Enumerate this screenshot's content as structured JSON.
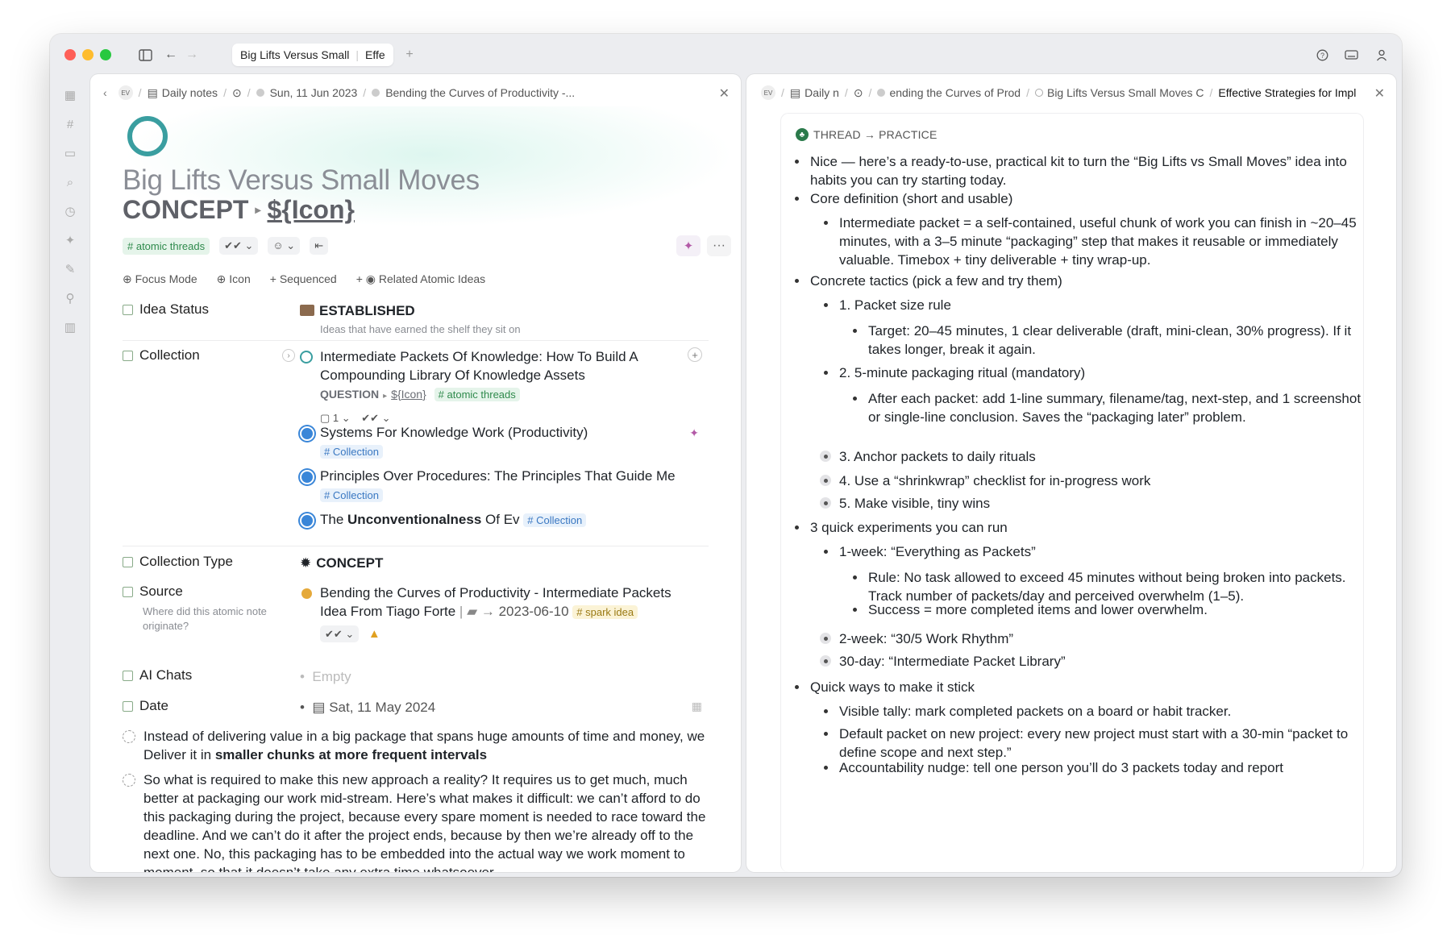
{
  "window": {
    "tabs": [
      {
        "label": "Big Lifts Versus Small",
        "active": true
      },
      {
        "label": "Effe",
        "active": true
      }
    ],
    "new_tab": "+"
  },
  "left_pane": {
    "breadcrumb": {
      "workspace": "EV",
      "daily_notes": "Daily notes",
      "date": "Sun, 11 Jun 2023",
      "parent": "Bending the Curves of Productivity -..."
    },
    "title": "Big Lifts Versus Small Moves",
    "type": "CONCEPT",
    "type_link": "${Icon}",
    "tag": "# atomic threads",
    "props_bar": {
      "focus_mode": "Focus Mode",
      "icon": "Icon",
      "sequenced": "Sequenced",
      "related": "Related Atomic Ideas"
    },
    "idea_status": {
      "label": "Idea Status",
      "value": "ESTABLISHED",
      "sub": "Ideas that have earned the shelf they sit on"
    },
    "collection": {
      "label": "Collection",
      "items": [
        {
          "title": "Intermediate Packets Of Knowledge: How To Build A Compounding Library Of Knowledge Assets",
          "type": "QUESTION",
          "type_link": "${Icon}",
          "tag": "# atomic threads",
          "count": "1"
        },
        {
          "title": "Systems For Knowledge Work (Productivity)",
          "tag": "# Collection"
        },
        {
          "title": "Principles Over Procedures: The Principles That Guide Me",
          "tag": "# Collection"
        },
        {
          "title_pre": "The ",
          "title_bold": "Unconventionalness",
          "title_post": " Of Ev",
          "tag": "# Collection"
        }
      ]
    },
    "collection_type": {
      "label": "Collection Type",
      "value": "CONCEPT"
    },
    "source": {
      "label": "Source",
      "sub": "Where did this atomic note originate?",
      "title": "Bending the Curves of Productivity - Intermediate Packets Idea From Tiago Forte",
      "date": "2023-06-10",
      "tag": "# spark idea"
    },
    "ai_chats": {
      "label": "AI Chats",
      "value": "Empty"
    },
    "date": {
      "label": "Date",
      "value": "Sat, 11 May 2024"
    },
    "notes": [
      {
        "pre": "Instead of delivering value in a big package that spans huge amounts of time and money, we Deliver it in ",
        "bold": "smaller chunks at more frequent intervals"
      },
      {
        "text": "So what is required to make this new approach a reality? It requires us to get much, much better at packaging our work mid-stream. Here’s what makes it difficult: we can’t afford to do this packaging during the project, because every spare moment is needed to race toward the deadline. And we can’t do it after the project ends, because by then we’re already off to the next one. No, this packaging has to be embedded into the actual way we work moment to moment, so that it doesn’t take any extra time whatsoever."
      }
    ]
  },
  "right_pane": {
    "breadcrumb": {
      "workspace": "EV",
      "daily": "Daily n",
      "c1": "ending the Curves of Prod",
      "c2": "Big Lifts Versus Small Moves C",
      "current": "Effective Strategies for Impl"
    },
    "thread_header": "THREAD → PRACTICE",
    "items": [
      {
        "level": 0,
        "text": "Nice — here’s a ready-to-use, practical kit to turn the “Big Lifts vs Small Moves” idea into habits you can try starting today."
      },
      {
        "level": 0,
        "text": "Core definition (short and usable)"
      },
      {
        "level": 1,
        "text": "Intermediate packet = a self-contained, useful chunk of work you can finish in ~20–45 minutes, with a 3–5 minute “packaging” step that makes it reusable or immediately valuable. Timebox + tiny deliverable + tiny wrap-up."
      },
      {
        "level": 0,
        "text": "Concrete tactics (pick a few and try them)"
      },
      {
        "level": 1,
        "text": "1. Packet size rule"
      },
      {
        "level": 2,
        "text": "Target: 20–45 minutes, 1 clear deliverable (draft, mini-clean, 30% progress). If it takes longer, break it again."
      },
      {
        "level": 1,
        "text": "2. 5-minute packaging ritual (mandatory)"
      },
      {
        "level": 2,
        "text": "After each packet: add 1-line summary, filename/tag, next-step, and 1 screenshot or single-line conclusion. Saves the “packaging later” problem."
      },
      {
        "level": 1,
        "collapsed": true,
        "text": "3. Anchor packets to daily rituals"
      },
      {
        "level": 1,
        "collapsed": true,
        "text": "4. Use a “shrinkwrap” checklist for in-progress work"
      },
      {
        "level": 1,
        "collapsed": true,
        "text": "5. Make visible, tiny wins"
      },
      {
        "level": 0,
        "text": "3 quick experiments you can run"
      },
      {
        "level": 1,
        "text": "1-week: “Everything as Packets”"
      },
      {
        "level": 2,
        "text": "Rule: No task allowed to exceed 45 minutes without being broken into packets. Track number of packets/day and perceived overwhelm (1–5)."
      },
      {
        "level": 2,
        "text": "Success = more completed items and lower overwhelm."
      },
      {
        "level": 1,
        "collapsed": true,
        "text": "2-week: “30/5 Work Rhythm”"
      },
      {
        "level": 1,
        "collapsed": true,
        "text": "30-day: “Intermediate Packet Library”"
      },
      {
        "level": 0,
        "text": "Quick ways to make it stick"
      },
      {
        "level": 1,
        "text": "Visible tally: mark completed packets on a board or habit tracker."
      },
      {
        "level": 1,
        "text": "Default packet on new project: every new project must start with a 30-min “packet to define scope and next step.”"
      },
      {
        "level": 1,
        "text": "Accountability nudge: tell one person you’ll do 3 packets today and report"
      }
    ]
  }
}
